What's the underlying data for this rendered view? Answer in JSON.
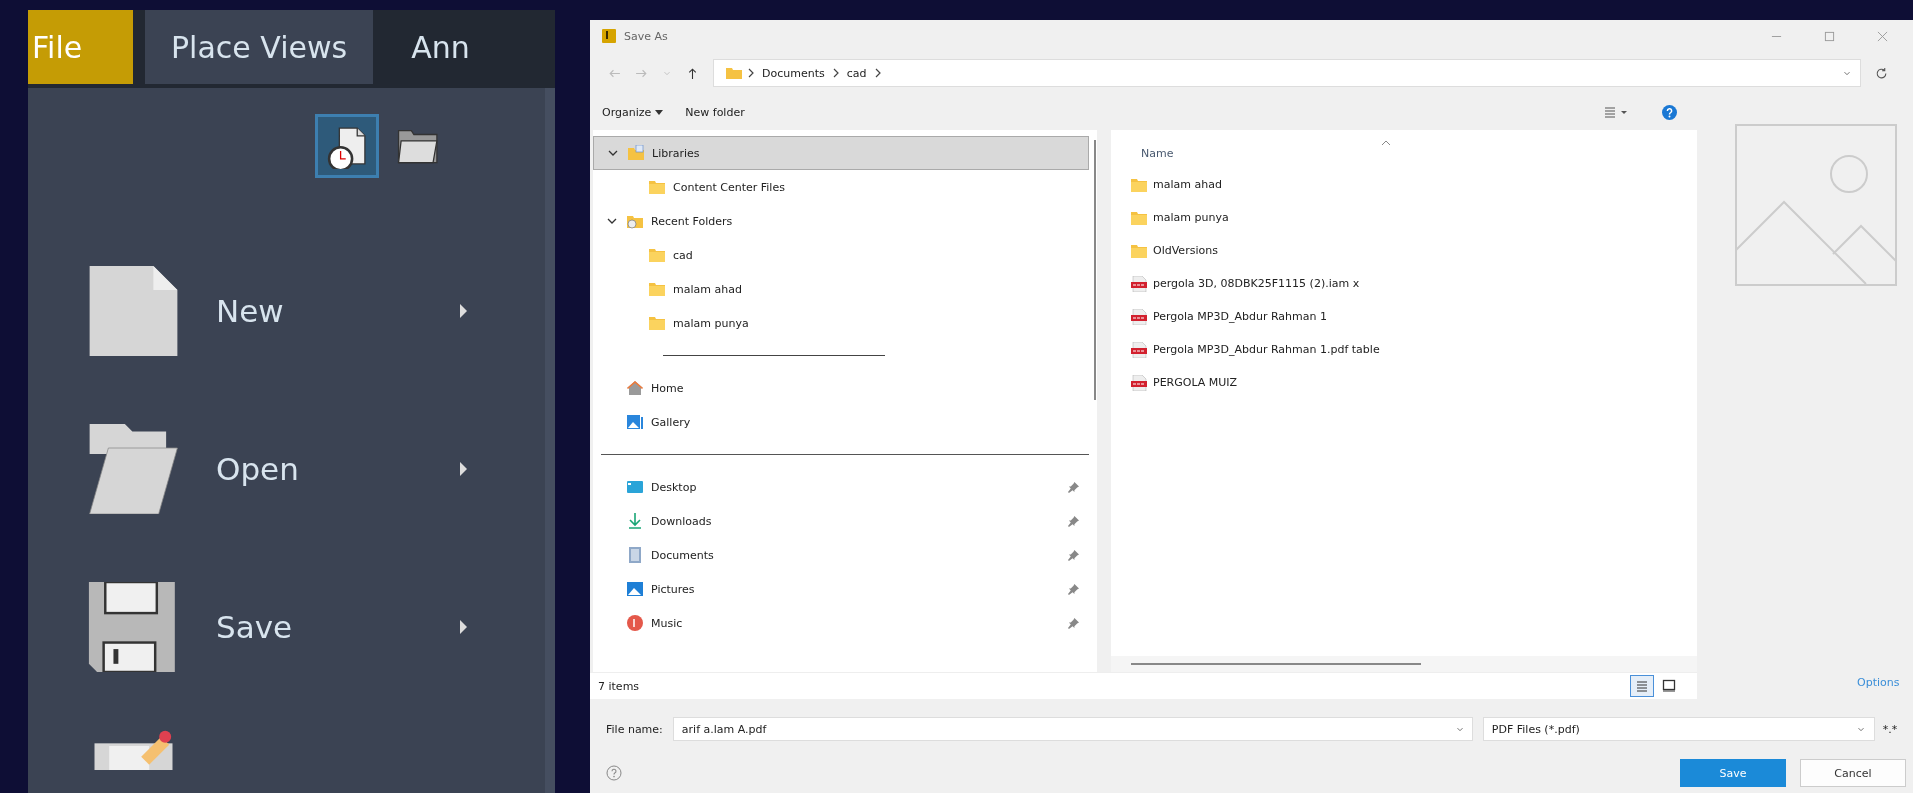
{
  "app_menu": {
    "tabs": [
      {
        "label": "File",
        "kind": "app",
        "selected": false
      },
      {
        "label": "Place Views",
        "kind": "tab",
        "selected": true
      },
      {
        "label": "Ann",
        "kind": "tab",
        "selected": false
      }
    ],
    "quick_icons": [
      {
        "kind": "recent",
        "selected": true
      },
      {
        "kind": "open",
        "selected": false
      }
    ],
    "items": [
      {
        "kind": "new",
        "label": "New",
        "submenu": true
      },
      {
        "kind": "open",
        "label": "Open",
        "submenu": true
      },
      {
        "kind": "save",
        "label": "Save",
        "submenu": true
      },
      {
        "kind": "edit",
        "submenu": false
      }
    ]
  },
  "dialog": {
    "title": "Save As",
    "address": {
      "path": [
        "Documents",
        "cad"
      ]
    },
    "toolbar": {
      "organize": "Organize",
      "new_folder": "New folder"
    },
    "nav": [
      {
        "kind": "library",
        "label": "Libraries",
        "expanded": true,
        "selected": true,
        "children": [
          {
            "kind": "folder",
            "label": "Content Center Files",
            "selected": false
          }
        ]
      },
      {
        "kind": "recent",
        "label": "Recent Folders",
        "expanded": true,
        "selected": false,
        "children": [
          {
            "kind": "folder",
            "label": "cad",
            "selected": false
          },
          {
            "kind": "folder",
            "label": "malam ahad",
            "selected": false
          },
          {
            "kind": "folder",
            "label": "malam punya",
            "selected": false
          }
        ]
      },
      {
        "kind": "separator"
      },
      {
        "kind": "home",
        "label": "Home",
        "selected": false
      },
      {
        "kind": "gallery",
        "label": "Gallery",
        "selected": false
      },
      {
        "kind": "divider"
      },
      {
        "kind": "desktop",
        "label": "Desktop",
        "pinned": true,
        "selected": false
      },
      {
        "kind": "downloads",
        "label": "Downloads",
        "pinned": true,
        "selected": false
      },
      {
        "kind": "documents",
        "label": "Documents",
        "pinned": true,
        "selected": false
      },
      {
        "kind": "pictures",
        "label": "Pictures",
        "pinned": true,
        "selected": false
      },
      {
        "kind": "music",
        "label": "Music",
        "pinned": true,
        "selected": false
      }
    ],
    "file_list": {
      "columns": [
        "Name"
      ],
      "files": [
        {
          "kind": "folder",
          "name": "malam ahad"
        },
        {
          "kind": "folder",
          "name": "malam punya"
        },
        {
          "kind": "folder",
          "name": "OldVersions"
        },
        {
          "kind": "pdf",
          "name": "pergola 3D, 08DBK25F1115 (2).iam x"
        },
        {
          "kind": "pdf",
          "name": "Pergola MP3D_Abdur Rahman 1"
        },
        {
          "kind": "pdf",
          "name": "Pergola MP3D_Abdur Rahman 1.pdf table"
        },
        {
          "kind": "pdf",
          "name": "PERGOLA MUIZ"
        }
      ]
    },
    "status": "7 items",
    "views": [
      {
        "kind": "details",
        "selected": true
      },
      {
        "kind": "preview",
        "selected": false
      }
    ],
    "options": "Options",
    "file_name": {
      "label": "File name:",
      "value": "arif a.lam A.pdf"
    },
    "file_type": {
      "value": "PDF Files (*.pdf)",
      "extra": "*.*"
    },
    "buttons": [
      {
        "kind": "primary",
        "label": "Save"
      },
      {
        "kind": "normal",
        "label": "Cancel"
      }
    ]
  }
}
